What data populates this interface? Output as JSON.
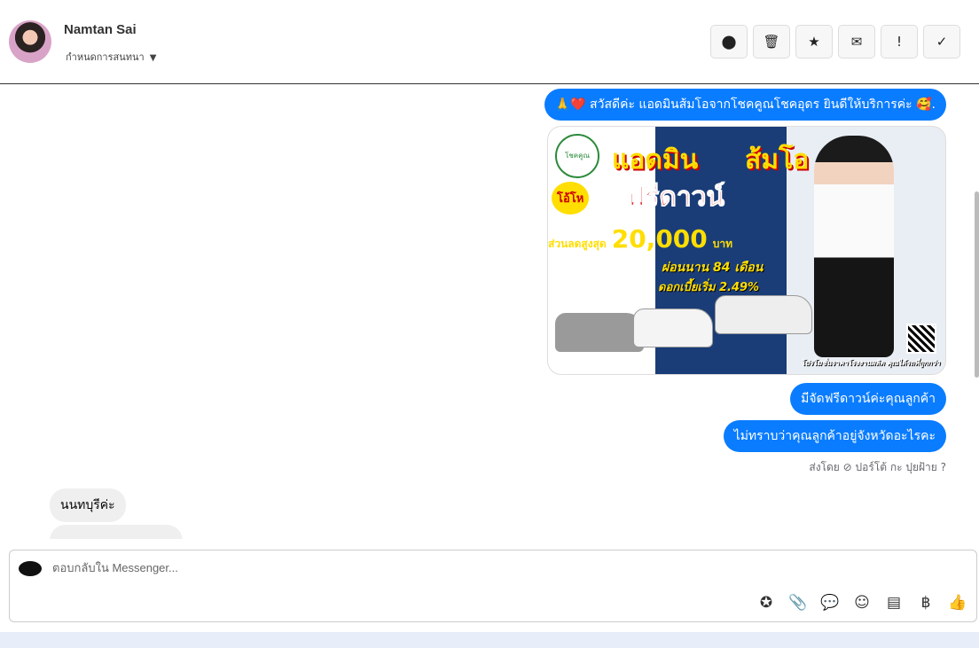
{
  "header": {
    "name": "Namtan Sai",
    "subtitle": "กำหนดการสนทนา",
    "caret": "▼",
    "tools": [
      {
        "name": "report-icon",
        "glyph": "⓿"
      },
      {
        "name": "trash-icon",
        "glyph": "🗑"
      },
      {
        "name": "star-icon",
        "glyph": "★"
      },
      {
        "name": "mail-icon",
        "glyph": "✉"
      },
      {
        "name": "important-icon",
        "glyph": "!"
      },
      {
        "name": "check-icon",
        "glyph": "✓"
      }
    ]
  },
  "messages": {
    "greeting": "🙏❤️ สวัสดีค่ะ แอดมินส้มโอจากโชคคูณโชคอุดร ยินดีให้บริการค่ะ 🥰.",
    "out1": "มีจัดฟรีดาวน์ค่ะคุณลูกค้า",
    "out2": "ไม่ทราบว่าคุณลูกค้าอยู่จังหวัดอะไรคะ",
    "meta": "ส่งโดย ⊘ ปอร์โต้ กะ ปุยฝ้าย ?",
    "in1": "นนทบุรีค่ะ",
    "in2": ""
  },
  "promo": {
    "logo": "โชคคูณ",
    "title_a": "แอดมิน",
    "title_b": "ส้มโอ",
    "wow": "โอ้โห",
    "free_down": "ฟรีดาวน์",
    "discount_label": "ส่วนลดสูงสุด",
    "discount": "20,000",
    "currency": "บาท",
    "installment": "ผ่อนนาน 84 เดือน",
    "interest": "ดอกเบี้ยเริ่ม 2.49%",
    "footer": "โปรโมชั่นราคาโรงงานผลิต คุณได้รถที่ถูกกว่า"
  },
  "composer": {
    "placeholder": "ตอบกลับใน Messenger...",
    "icons": [
      {
        "name": "saved-reply-icon",
        "glyph": "✪"
      },
      {
        "name": "attach-icon",
        "glyph": "📎"
      },
      {
        "name": "quick-reply-icon",
        "glyph": "💬"
      },
      {
        "name": "emoji-icon",
        "glyph": "☺"
      },
      {
        "name": "catalog-icon",
        "glyph": "▤"
      },
      {
        "name": "payment-icon",
        "glyph": "฿"
      },
      {
        "name": "like-icon",
        "glyph": "👍"
      }
    ]
  }
}
